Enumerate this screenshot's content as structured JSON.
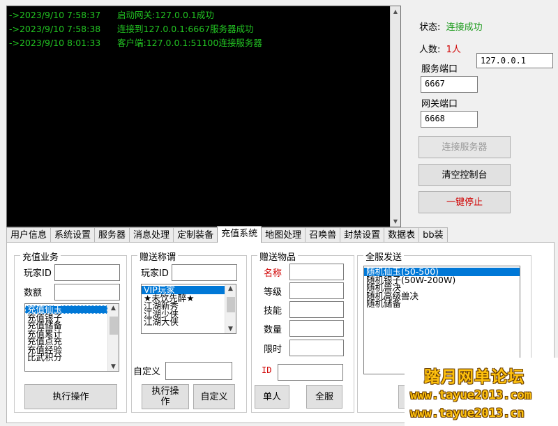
{
  "console": {
    "lines": [
      {
        "time": "->2023/9/10 7:58:37",
        "message": "启动网关:127.0.0.1成功"
      },
      {
        "time": "->2023/9/10 7:58:38",
        "message": "连接到127.0.0.1:6667服务器成功"
      },
      {
        "time": "->2023/9/10 8:01:33",
        "message": "客户端:127.0.0.1:51100连接服务器"
      }
    ],
    "text_color": "#22c322"
  },
  "side": {
    "status_label": "状态:",
    "status_value": "连接成功",
    "count_label": "人数:",
    "count_value": "1人",
    "ip_value": "127.0.0.1",
    "server_port_label": "服务端口",
    "server_port_value": "6667",
    "gateway_port_label": "网关端口",
    "gateway_port_value": "6668",
    "connect_button": "连接服务器",
    "clear_button": "清空控制台",
    "stop_button": "一键停止"
  },
  "tabs": [
    "用户信息",
    "系统设置",
    "服务器",
    "消息处理",
    "定制装备",
    "充值系统",
    "地图处理",
    "召唤兽",
    "封禁设置",
    "数据表",
    "bb装"
  ],
  "active_tab": "充值系统",
  "recharge": {
    "title": "充值业务",
    "player_id_label": "玩家ID",
    "amount_label": "数额",
    "items": [
      "充值仙玉",
      "充值银子",
      "充值储备",
      "充值累计",
      "充值点充",
      "充值经验",
      "比武积分"
    ],
    "execute_button": "执行操作"
  },
  "gift_title": {
    "title": "赠送称谓",
    "player_id_label": "玩家ID",
    "items": [
      "VIP玩家",
      "★未饮先醉★",
      "江湖新秀",
      "江湖少侠",
      "江湖大侠"
    ],
    "custom_label": "自定义",
    "execute_button": "执行操作",
    "custom_button": "自定义"
  },
  "gift_item": {
    "title": "赠送物品",
    "name_label": "名称",
    "level_label": "等级",
    "skill_label": "技能",
    "quantity_label": "数量",
    "time_limit_label": "限时",
    "id_label": "ID",
    "single_button": "单人",
    "all_button": "全服"
  },
  "server_send": {
    "title": "全服发送",
    "items": [
      "随机仙玉(50-500)",
      "随机银子(50W-200W)",
      "随机兽决",
      "随机高级兽决",
      "随机储备"
    ]
  },
  "watermark": {
    "title": "踏月网单论坛",
    "url1": "www.tayue2013.com",
    "url2": "www.tayue2013.cn"
  }
}
